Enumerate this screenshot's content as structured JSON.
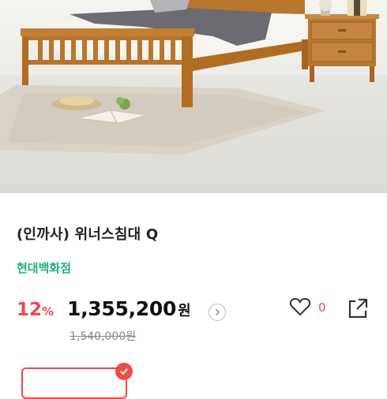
{
  "product": {
    "title": "(인까사) 위너스침대 Q",
    "store": "현대백화점",
    "discount_number": "12",
    "discount_unit": "%",
    "price": "1,355,200",
    "price_unit": "원",
    "original_price": "1,540,000",
    "original_unit": "원",
    "like_count": "0"
  },
  "colors": {
    "accent": "#f0494a",
    "store_green": "#20b07a",
    "wood": "#b9772d"
  },
  "icons": {
    "chevron": "chevron-right-icon",
    "like": "heart-icon",
    "share": "share-icon",
    "check": "check-icon"
  }
}
